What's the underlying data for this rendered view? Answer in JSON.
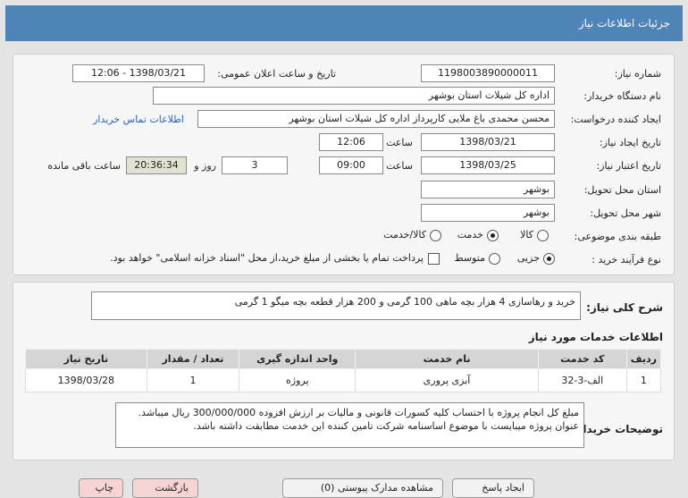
{
  "window": {
    "title": "جزئیات اطلاعات نیاز"
  },
  "form": {
    "need_number": {
      "label": "شماره نیاز:",
      "value": "1198003890000011"
    },
    "announce_datetime": {
      "label": "تاریخ و ساعت اعلان عمومی:",
      "value": "1398/03/21 - 12:06"
    },
    "buyer_org": {
      "label": "نام دستگاه خریدار:",
      "value": "اداره کل شیلات استان بوشهر"
    },
    "requester": {
      "label": "ایجاد کننده درخواست:",
      "value": "محسن محمدی باغ ملایی کارپرداز اداره کل شیلات استان بوشهر",
      "contact_link": "اطلاعات تماس خریدار"
    },
    "created": {
      "label": "تاریخ ایجاد نیاز:",
      "date": "1398/03/21",
      "time_label": "ساعت",
      "time": "12:06"
    },
    "validity": {
      "label": "تاریخ اعتبار نیاز:",
      "date": "1398/03/25",
      "time_label": "ساعت",
      "time": "09:00",
      "days": "3",
      "days_label": "روز و",
      "remaining": "20:36:34",
      "remaining_label": "ساعت باقی مانده"
    },
    "delivery_province": {
      "label": "استان محل تحویل:",
      "value": "بوشهر"
    },
    "delivery_city": {
      "label": "شهر محل تحویل:",
      "value": "بوشهر"
    },
    "category": {
      "label": "طبقه بندی موضوعی:",
      "options": [
        {
          "label": "کالا",
          "selected": false
        },
        {
          "label": "خدمت",
          "selected": true
        },
        {
          "label": "کالا/خدمت",
          "selected": false
        }
      ]
    },
    "purchase_process": {
      "label": "نوع فرآیند خرید :",
      "options": [
        {
          "label": "جزیی",
          "selected": true
        },
        {
          "label": "متوسط",
          "selected": false
        }
      ],
      "payment_note": "پرداخت تمام یا بخشی از مبلغ خرید،از محل \"اسناد خزانه اسلامی\" خواهد بود."
    }
  },
  "summary": {
    "label": "شرح کلی نیاز:",
    "value": "خرید و رهاسازی 4 هزار بچه ماهی 100 گرمی و 200 هزار قطعه بچه میگو 1 گرمی"
  },
  "services": {
    "title": "اطلاعات خدمات مورد نیاز",
    "columns": [
      "ردیف",
      "کد خدمت",
      "نام خدمت",
      "واحد اندازه گیری",
      "تعداد / مقدار",
      "تاریخ نیاز"
    ],
    "rows": [
      [
        "1",
        "الف-3-32",
        "آبزی پروری",
        "پروژه",
        "1",
        "1398/03/28"
      ]
    ]
  },
  "buyer_notes": {
    "label": "توضیحات خریدار:",
    "lines": [
      "مبلغ کل انجام پروژه با احتساب کلیه کسورات قانونی و مالیات بر ارزش افزوده 300/000/000 ریال میباشد.",
      "عنوان پروژه میبایست با موضوع اساسنامه شرکت تامین کننده این خدمت مطابقت داشته باشد."
    ]
  },
  "buttons": {
    "print": "چاپ",
    "back": "بازگشت",
    "attachments": "مشاهده مدارک پیوستی (0)",
    "reply": "ایجاد پاسخ"
  }
}
